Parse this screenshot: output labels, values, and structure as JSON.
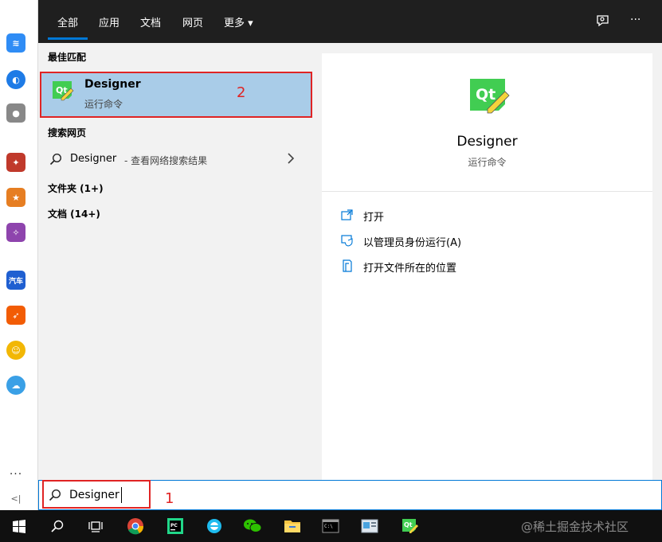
{
  "left_strip": {
    "items": [
      {
        "icon": "blue-app-icon",
        "color": "#2f8cf5"
      },
      {
        "icon": "blue-circle-app-icon",
        "color": "#1e7be6"
      },
      {
        "icon": "apple-icon",
        "color": "#888888"
      },
      {
        "icon": "game-app-icon",
        "color": "#c0392b"
      },
      {
        "icon": "game-app-2-icon",
        "color": "#e67e22"
      },
      {
        "icon": "game-app-3-icon",
        "color": "#8e44ad"
      },
      {
        "icon": "car-app-icon",
        "color": "#1f5fd1",
        "label": "汽车"
      },
      {
        "icon": "orange-app-icon",
        "color": "#f25c05"
      },
      {
        "icon": "yellow-app-icon",
        "color": "#f2b705"
      },
      {
        "icon": "cloud-app-icon",
        "color": "#3aa0e6"
      }
    ],
    "more_label": "···",
    "collapse_label": "<|"
  },
  "topbar": {
    "tabs": [
      "全部",
      "应用",
      "文档",
      "网页",
      "更多 ▾"
    ],
    "active_tab": "全部",
    "accent": "#0078d7",
    "feedback_icon": "feedback-icon",
    "more_icon": "ellipsis-icon",
    "more_glyph": "···"
  },
  "results": {
    "best_match_heading": "最佳匹配",
    "best_match": {
      "title": "Designer",
      "subtitle": "运行命令",
      "icon": "qt-designer-icon"
    },
    "web_heading": "搜索网页",
    "web_result": {
      "term": "Designer",
      "desc": "- 查看网络搜索结果"
    },
    "categories": [
      "文件夹 (1+)",
      "文档 (14+)"
    ]
  },
  "detail": {
    "title": "Designer",
    "subtitle": "运行命令",
    "icon": "qt-designer-icon",
    "actions": [
      {
        "label": "打开",
        "icon": "open-icon"
      },
      {
        "label": "以管理员身份运行(A)",
        "icon": "admin-run-icon"
      },
      {
        "label": "打开文件所在的位置",
        "icon": "file-location-icon"
      }
    ]
  },
  "annotations": {
    "label_1": "1",
    "label_2": "2",
    "highlight_color": "#e02424"
  },
  "search": {
    "value": "Designer"
  },
  "taskbar": {
    "apps": [
      "windows-start-icon",
      "search-icon",
      "task-view-icon",
      "chrome-icon",
      "pycharm-icon",
      "ie-icon",
      "wechat-icon",
      "file-explorer-icon",
      "terminal-icon",
      "notes-app-icon",
      "qt-designer-icon"
    ],
    "watermark": "@稀土掘金技术社区"
  }
}
